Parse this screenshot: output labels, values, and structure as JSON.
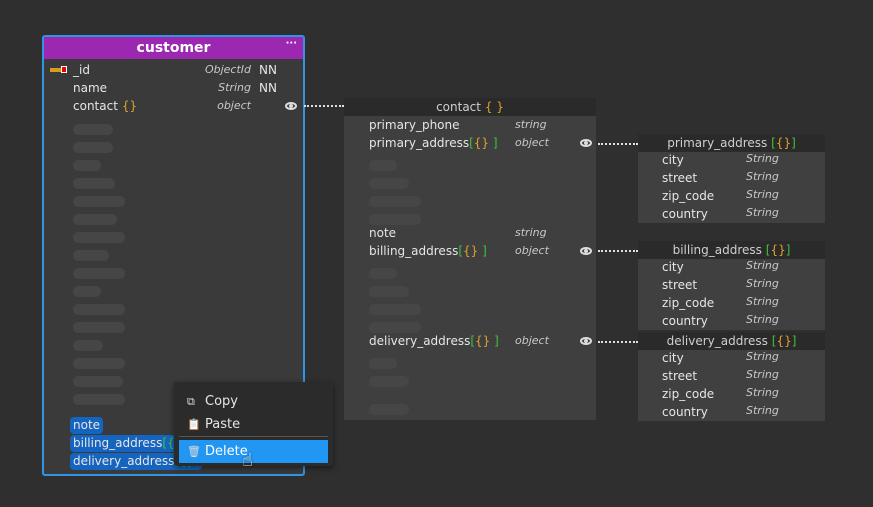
{
  "colors": {
    "accent": "#2196f3",
    "header": "#9c27b0",
    "selection": "#1565c0"
  },
  "customer": {
    "title": "customer",
    "menu_icon": "ellipsis-icon",
    "fields": [
      {
        "name": "_id",
        "type": "ObjectId",
        "nn": "NN",
        "key": true
      },
      {
        "name": "name",
        "type": "String",
        "nn": "NN"
      },
      {
        "name": "contact",
        "brace": "{}",
        "type": "object",
        "eye": true
      }
    ],
    "selected": [
      {
        "name": "note"
      },
      {
        "name": "billing_address",
        "brace": "[{}]"
      },
      {
        "name": "delivery_address",
        "brace": "[{}]"
      }
    ]
  },
  "context_menu": {
    "items": [
      {
        "label": "Copy",
        "icon": "copy-icon"
      },
      {
        "label": "Paste",
        "icon": "paste-icon"
      },
      {
        "label": "Delete",
        "icon": "trash-icon",
        "highlighted": true
      }
    ]
  },
  "contact": {
    "title": "contact",
    "brace": "{ }",
    "fields": [
      {
        "name": "primary_phone",
        "type": "string"
      },
      {
        "name": "primary_address",
        "brace1": "[",
        "brace2": "{}",
        "brace3": " ]",
        "type": "object",
        "eye": true
      },
      {
        "name": "note",
        "type": "string"
      },
      {
        "name": "billing_address",
        "brace1": "[",
        "brace2": "{}",
        "brace3": " ]",
        "type": "object",
        "eye": true
      },
      {
        "name": "delivery_address",
        "brace1": "[",
        "brace2": "{}",
        "brace3": " ]",
        "type": "object",
        "eye": true
      }
    ]
  },
  "subdocs": [
    {
      "title": "primary_address",
      "fields": [
        {
          "name": "city",
          "type": "String"
        },
        {
          "name": "street",
          "type": "String"
        },
        {
          "name": "zip_code",
          "type": "String"
        },
        {
          "name": "country",
          "type": "String"
        }
      ]
    },
    {
      "title": "billing_address",
      "fields": [
        {
          "name": "city",
          "type": "String"
        },
        {
          "name": "street",
          "type": "String"
        },
        {
          "name": "zip_code",
          "type": "String"
        },
        {
          "name": "country",
          "type": "String"
        }
      ]
    },
    {
      "title": "delivery_address",
      "fields": [
        {
          "name": "city",
          "type": "String"
        },
        {
          "name": "street",
          "type": "String"
        },
        {
          "name": "zip_code",
          "type": "String"
        },
        {
          "name": "country",
          "type": "String"
        }
      ]
    }
  ]
}
